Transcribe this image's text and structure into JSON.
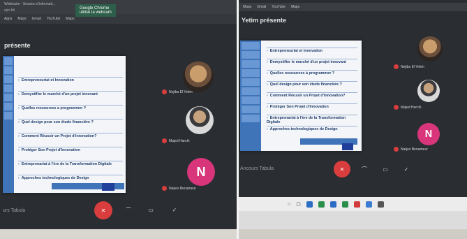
{
  "left": {
    "tab_title": "Webinaire - Session d'informati...",
    "url": "ejm-fdi",
    "bookmarks": [
      "Apps",
      "Maps",
      "Gmail",
      "YouTube",
      "Maps"
    ],
    "toast_title": "Google Chrome",
    "toast_sub": "utilise la webcam",
    "presenting": "présente",
    "bullets": [
      "Entrepreneuriat et Innovation",
      "Demystifier le marché d'un projet innovant",
      "Quelles ressources a programmer ?",
      "Quel design pour son étude financière ?",
      "Comment Réussir un Projet d'innovation?",
      "Protéger Son Projet d'Innovation",
      "Entreprenariat à l'ère de la Transformation Digitale",
      "Approches technologiques de Design"
    ],
    "participants": [
      {
        "name": "Nejiba El Yetim",
        "type": "photo1"
      },
      {
        "name": "Majed Harchi",
        "type": "photo2"
      },
      {
        "name": "Narjes Benameur",
        "type": "letter",
        "letter": "N"
      }
    ],
    "bottom_label": "urs Tabula"
  },
  "right": {
    "tabs": [
      "Maps",
      "Gmail",
      "YouTube",
      "Maps"
    ],
    "presenting": "Yetim présente",
    "bullets": [
      "Entrepreneuriat et Innovation",
      "Demystifier le marché d'un projet innovant",
      "Quelles ressources à programmer ?",
      "Quel design pour son étude financière ?",
      "Comment Réussir un Projet d'innovation?",
      "Protéger Son Projet d'Innovation",
      "Entreprenariat à l'ère de la Transformation Digitale",
      "Approches technologiques de Design"
    ],
    "participants": [
      {
        "name": "Nejiba El Yetim",
        "type": "photo1"
      },
      {
        "name": "Majed Harchi",
        "type": "photo2"
      },
      {
        "name": "Narjes Benameur",
        "type": "letter",
        "letter": "N"
      }
    ],
    "bottom_label": "Ancours Tabula"
  },
  "colors": {
    "hangup": "#d93d3d",
    "avatar_letter_bg": "#d8357a",
    "slide_accent": "#3f74b8"
  }
}
